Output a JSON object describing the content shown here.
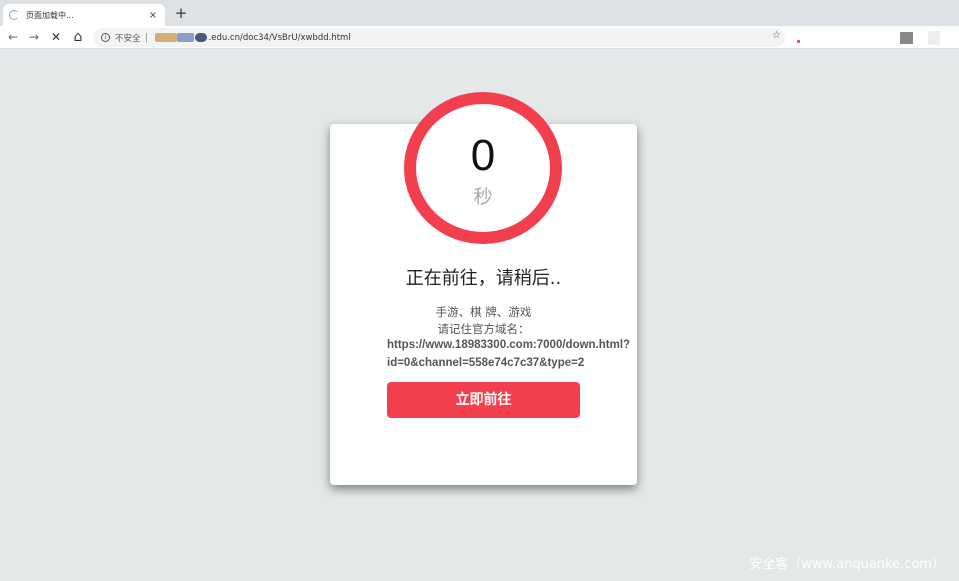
{
  "browser": {
    "tab_title": "页面加载中...",
    "tab_close": "×",
    "new_tab": "+",
    "back": "←",
    "forward": "→",
    "stop": "✕",
    "home": "⌂",
    "info": "i",
    "insecure_label": "不安全",
    "url_visible": ".edu.cn/doc34/VsBrU/xwbdd.html",
    "star": "☆"
  },
  "page": {
    "countdown_value": "0",
    "countdown_unit": "秒",
    "heading": "正在前往，请稍后..",
    "subtitle_line1": "手游、棋 牌、游戏",
    "subtitle_line2": "请记住官方域名：",
    "link_line1": "https://www.18983300.com:7000/down.html?",
    "link_line2": "id=0&channel=558e74c7c37&type=2",
    "go_button": "立即前往"
  },
  "watermark": "安全客（www.anquanke.com）",
  "colors": {
    "accent": "#f23f4d",
    "background": "#e4e8e8"
  }
}
